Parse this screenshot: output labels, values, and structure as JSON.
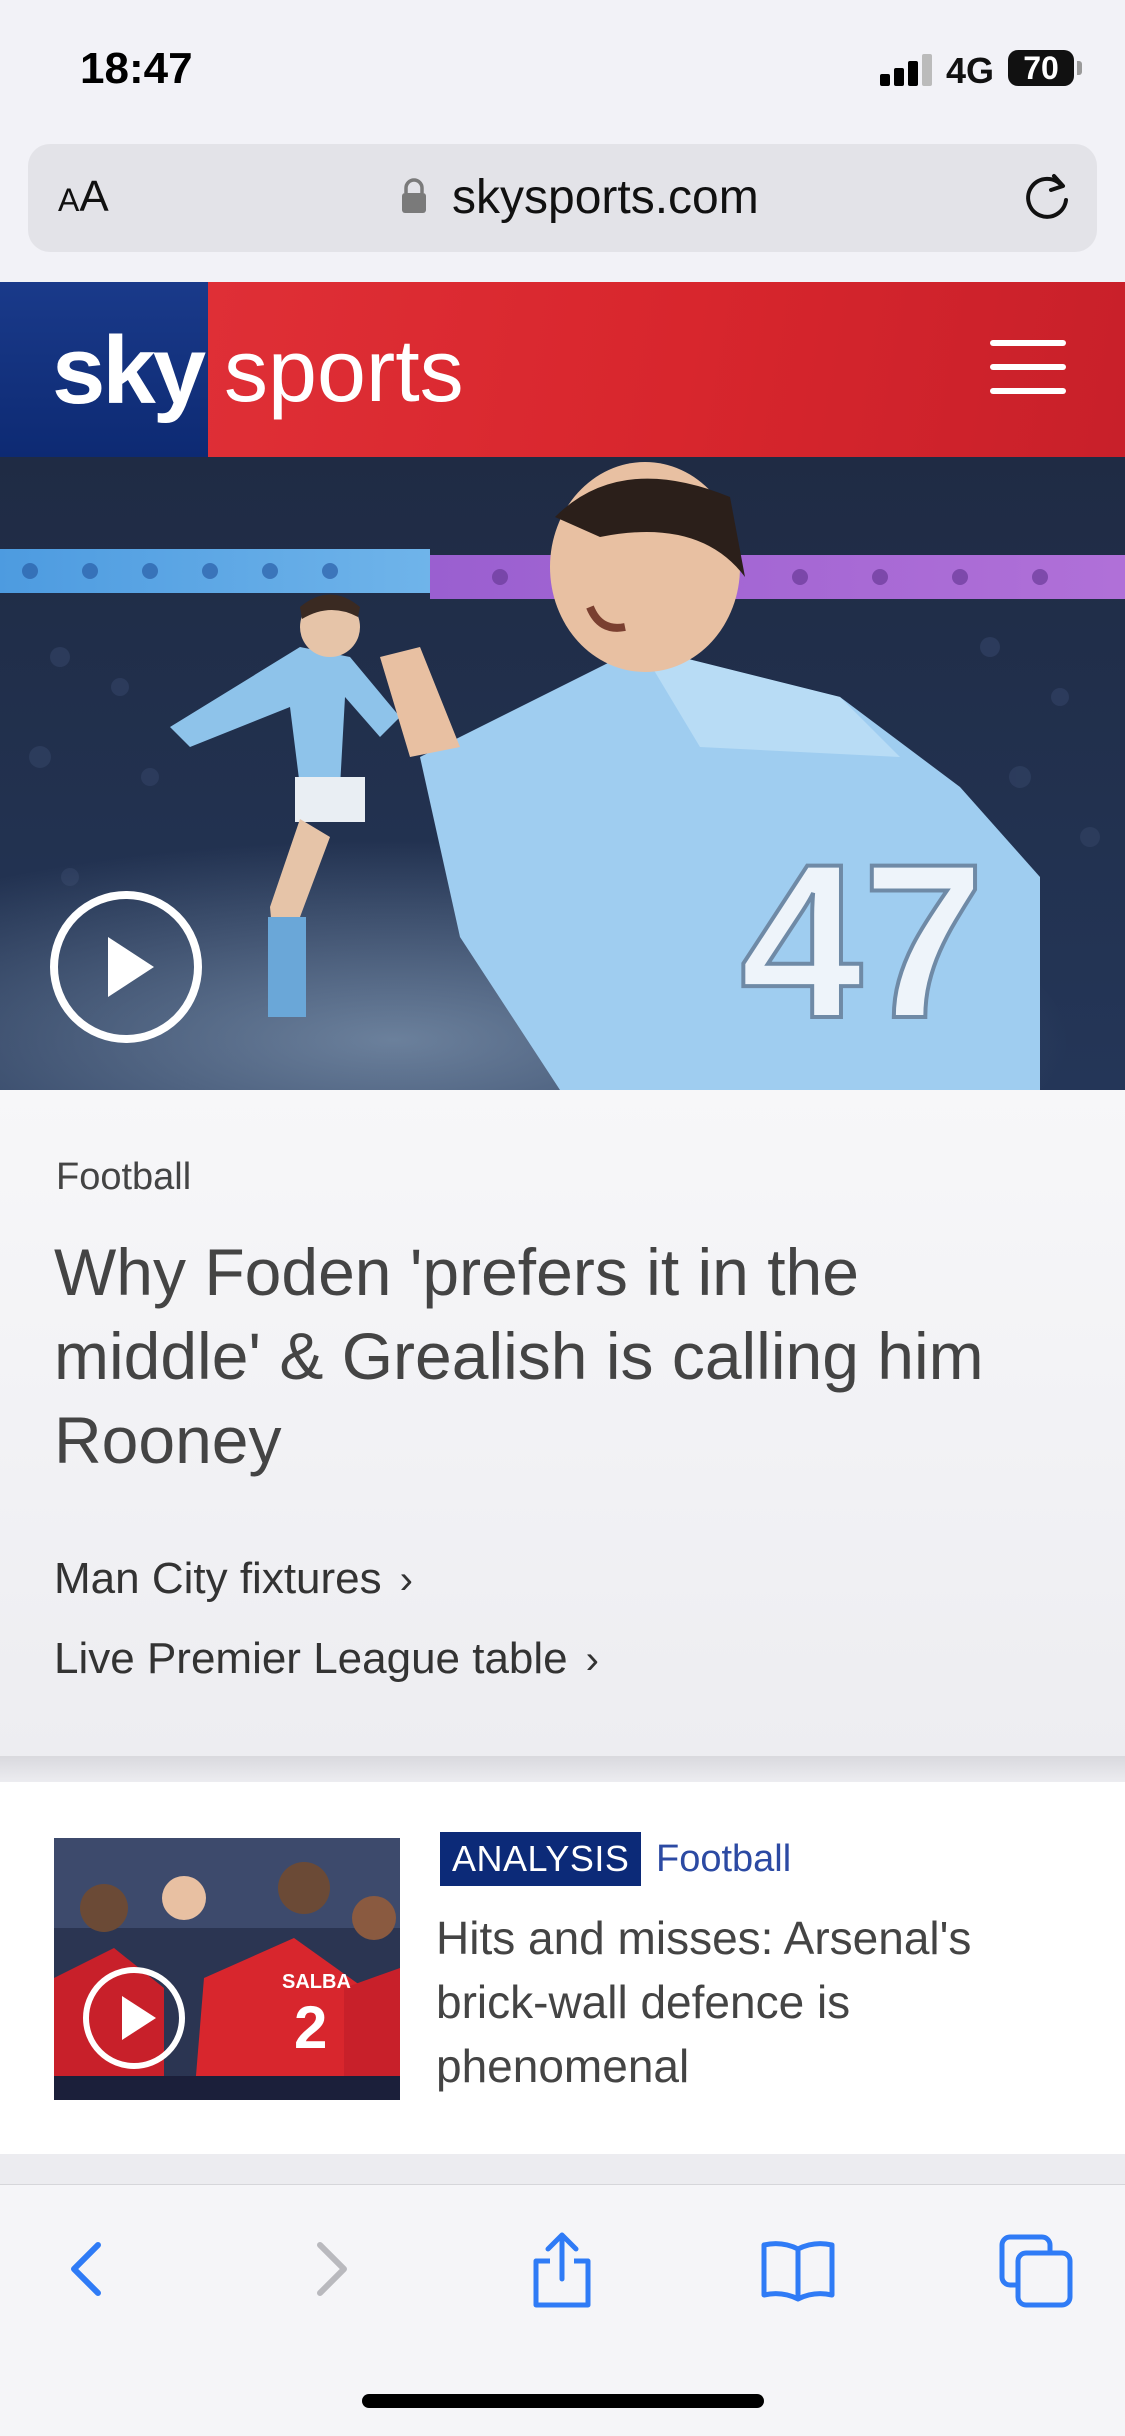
{
  "status": {
    "time": "18:47",
    "network": "4G",
    "battery": "70"
  },
  "address_bar": {
    "text_size": "AA",
    "url": "skysports.com"
  },
  "header": {
    "logo_sky": "sky",
    "logo_sports": "sports"
  },
  "hero": {
    "category": "Football",
    "headline": "Why Foden 'prefers it in the middle' & Grealish is calling him Rooney",
    "links": [
      "Man City fixtures",
      "Live Premier League table"
    ]
  },
  "article": {
    "badge": "ANALYSIS",
    "category": "Football",
    "title": "Hits and misses: Arsenal's brick-wall defence is phenomenal"
  },
  "colors": {
    "sky_red": "#d8262d",
    "sky_blue": "#0d2a73",
    "ios_blue": "#2f7bf6"
  },
  "toolbar": {
    "icons": [
      "back-icon",
      "forward-icon",
      "share-icon",
      "bookmarks-icon",
      "tabs-icon"
    ]
  }
}
